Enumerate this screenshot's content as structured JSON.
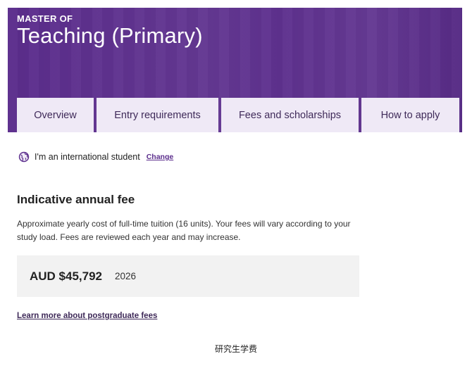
{
  "hero": {
    "kicker": "MASTER OF",
    "title": "Teaching (Primary)",
    "background_color": "#5b2d8c"
  },
  "tabs": [
    {
      "label": "Overview"
    },
    {
      "label": "Entry requirements"
    },
    {
      "label": "Fees and scholarships"
    },
    {
      "label": "How to apply"
    }
  ],
  "student_status": {
    "icon": "globe-icon",
    "text": "I'm an international student",
    "change_label": "Change"
  },
  "fees": {
    "heading": "Indicative annual fee",
    "description": "Approximate yearly cost of full-time tuition (16 units). Your fees will vary according to your study load. Fees are reviewed each year and may increase.",
    "amount": "AUD $45,792",
    "year": "2026",
    "learn_more_label": "Learn more about postgraduate fees"
  },
  "caption": "研究生学费",
  "colors": {
    "accent": "#5b2d8c",
    "tab_background": "#efe9f6",
    "fee_box_background": "#f2f2f2"
  }
}
